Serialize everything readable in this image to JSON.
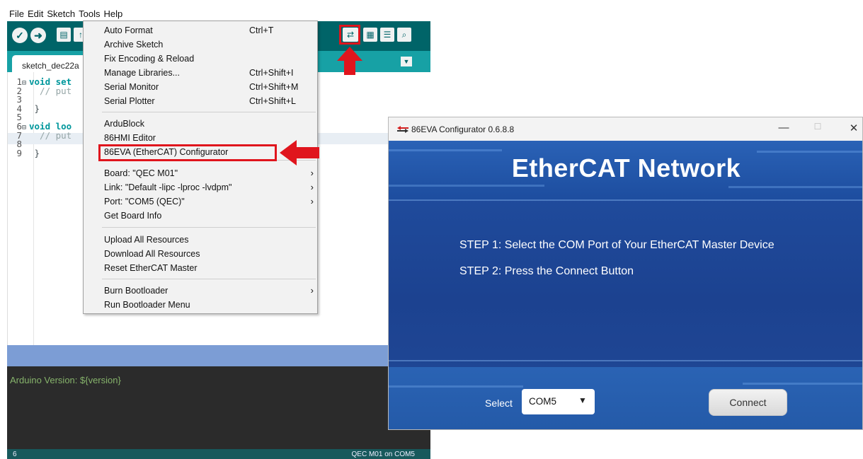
{
  "ide": {
    "menubar": [
      "File",
      "Edit",
      "Sketch",
      "Tools",
      "Help"
    ],
    "tab_name": "sketch_dec22a",
    "code_lines": [
      {
        "num": "1",
        "fold": "⊟",
        "kw": "void",
        "text": " set"
      },
      {
        "num": "2",
        "fold": "",
        "kw": "",
        "text": "  // put"
      },
      {
        "num": "3",
        "fold": "",
        "kw": "",
        "text": ""
      },
      {
        "num": "4",
        "fold": "",
        "kw": "",
        "text": " }"
      },
      {
        "num": "5",
        "fold": "",
        "kw": "",
        "text": ""
      },
      {
        "num": "6",
        "fold": "⊟",
        "kw": "void",
        "text": " loo"
      },
      {
        "num": "7",
        "fold": "",
        "kw": "",
        "text": "  // put"
      },
      {
        "num": "8",
        "fold": "",
        "kw": "",
        "text": ""
      },
      {
        "num": "9",
        "fold": "",
        "kw": "",
        "text": " }"
      }
    ],
    "console_text": "Arduino Version: ${version}",
    "status_line": "6",
    "status_board": "QEC M01 on COM5"
  },
  "tools_menu": {
    "items": [
      {
        "label": "Auto Format",
        "shortcut": "Ctrl+T",
        "submenu": false
      },
      {
        "label": "Archive Sketch",
        "shortcut": "",
        "submenu": false
      },
      {
        "label": "Fix Encoding & Reload",
        "shortcut": "",
        "submenu": false
      },
      {
        "label": "Manage Libraries...",
        "shortcut": "Ctrl+Shift+I",
        "submenu": false
      },
      {
        "label": "Serial Monitor",
        "shortcut": "Ctrl+Shift+M",
        "submenu": false
      },
      {
        "label": "Serial Plotter",
        "shortcut": "Ctrl+Shift+L",
        "submenu": false
      },
      {
        "label": "ArduBlock",
        "shortcut": "",
        "submenu": false
      },
      {
        "label": "86HMI Editor",
        "shortcut": "",
        "submenu": false
      },
      {
        "label": "86EVA (EtherCAT) Configurator",
        "shortcut": "",
        "submenu": false
      },
      {
        "label": "Board: \"QEC M01\"",
        "shortcut": "",
        "submenu": true
      },
      {
        "label": "Link: \"Default -lipc -lproc -lvdpm\"",
        "shortcut": "",
        "submenu": true
      },
      {
        "label": "Port: \"COM5 (QEC)\"",
        "shortcut": "",
        "submenu": true
      },
      {
        "label": "Get Board Info",
        "shortcut": "",
        "submenu": false
      },
      {
        "label": "Upload All Resources",
        "shortcut": "",
        "submenu": false
      },
      {
        "label": "Download All Resources",
        "shortcut": "",
        "submenu": false
      },
      {
        "label": "Reset EtherCAT Master",
        "shortcut": "",
        "submenu": false
      },
      {
        "label": "Burn Bootloader",
        "shortcut": "",
        "submenu": true
      },
      {
        "label": "Run Bootloader Menu",
        "shortcut": "",
        "submenu": false
      }
    ],
    "highlight_color": "#e0151d"
  },
  "configurator": {
    "title": "86EVA Configurator 0.6.8.8",
    "heading": "EtherCAT  Network",
    "step1": "STEP 1: Select the COM Port of Your EtherCAT Master Device",
    "step2": "STEP 2: Press the Connect Button",
    "select_label": "Select",
    "port_value": "COM5",
    "connect_label": "Connect",
    "window_controls": [
      "—",
      "☐",
      "✕"
    ],
    "background_color": "#1e4596"
  },
  "colors": {
    "ide_toolbar": "#006468",
    "ide_tabbar": "#17a1a5",
    "annotation_red": "#e0151d"
  }
}
